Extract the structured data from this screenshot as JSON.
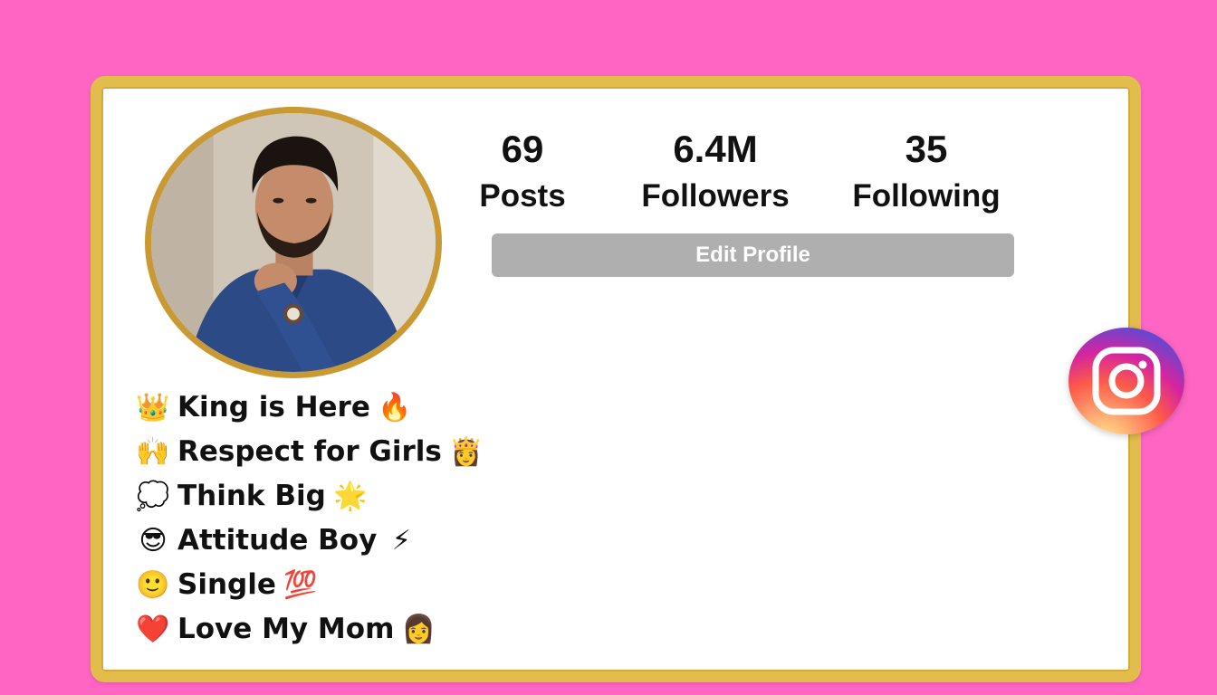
{
  "profile": {
    "stats": {
      "posts": {
        "value": "69",
        "label": "Posts"
      },
      "followers": {
        "value": "6.4M",
        "label": "Followers"
      },
      "following": {
        "value": "35",
        "label": "Following"
      }
    },
    "edit_button_label": "Edit Profile"
  },
  "bio": [
    {
      "lead_emoji": "👑",
      "text": "King is Here",
      "trail_emoji": "🔥"
    },
    {
      "lead_emoji": "🙌",
      "text": "Respect for Girls",
      "trail_emoji": "👸"
    },
    {
      "lead_emoji": "💭",
      "text": "Think Big",
      "trail_emoji": "🌟"
    },
    {
      "lead_emoji": "😎",
      "text": "Attitude Boy",
      "trail_emoji": "⚡"
    },
    {
      "lead_emoji": "🙂",
      "text": "Single",
      "trail_emoji": "💯"
    },
    {
      "lead_emoji": "❤️",
      "text": "Love My Mom",
      "trail_emoji": "👩"
    }
  ],
  "icons": {
    "avatar": "profile-photo",
    "brand": "instagram-icon"
  },
  "colors": {
    "background": "#ff66c4",
    "card_border": "#e2bd4c",
    "button": "#afafaf"
  }
}
